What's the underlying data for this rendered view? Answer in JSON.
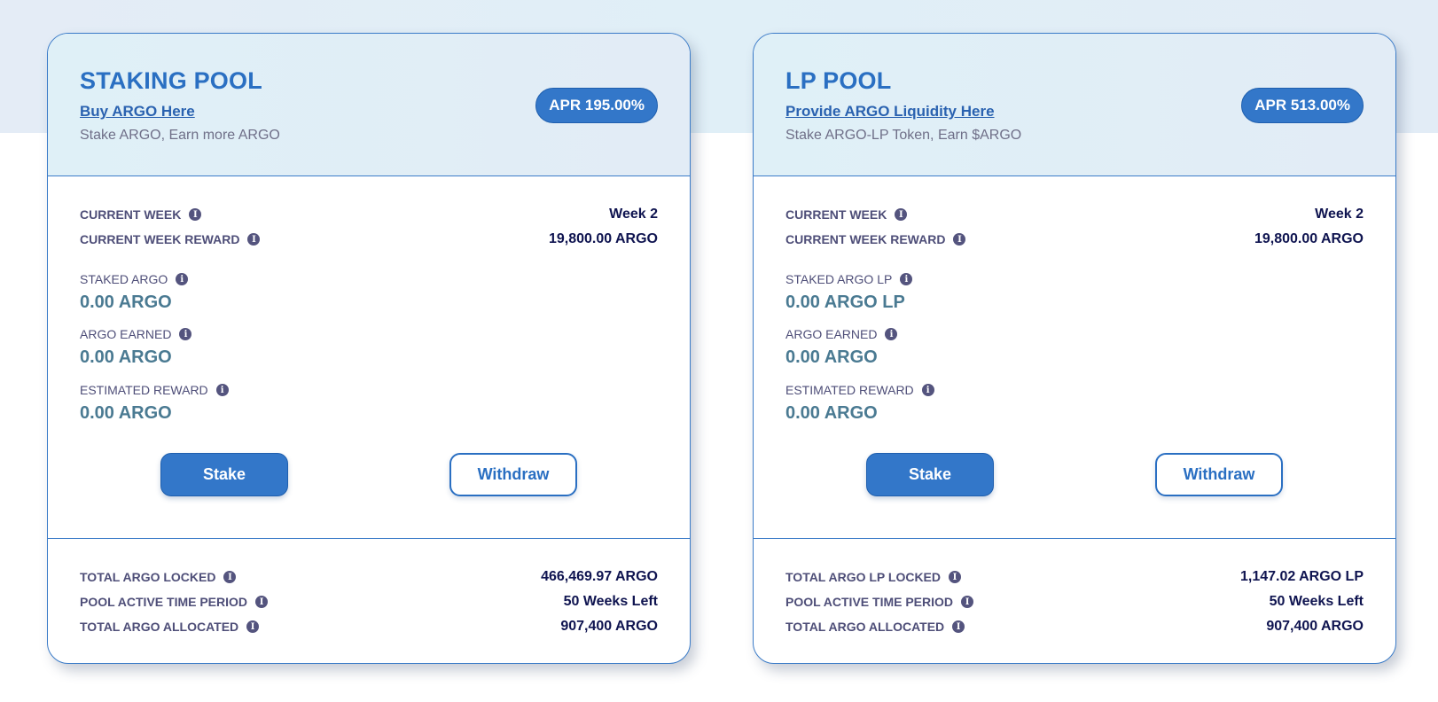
{
  "pools": [
    {
      "title": "STAKING POOL",
      "link": "Buy ARGO Here",
      "subtitle": "Stake ARGO, Earn more ARGO",
      "apr": "APR 195.00%",
      "current_week_label": "CURRENT WEEK",
      "current_week_value": "Week 2",
      "current_week_reward_label": "CURRENT WEEK REWARD",
      "current_week_reward_value": "19,800.00 ARGO",
      "staked_label": "STAKED ARGO",
      "staked_value": "0.00 ARGO",
      "earned_label": "ARGO EARNED",
      "earned_value": "0.00 ARGO",
      "estimated_label": "ESTIMATED REWARD",
      "estimated_value": "0.00 ARGO",
      "stake_button": "Stake",
      "withdraw_button": "Withdraw",
      "total_locked_label": "TOTAL ARGO LOCKED",
      "total_locked_value": "466,469.97 ARGO",
      "active_period_label": "POOL ACTIVE TIME PERIOD",
      "active_period_value": "50 Weeks Left",
      "total_allocated_label": "TOTAL ARGO ALLOCATED",
      "total_allocated_value": "907,400 ARGO"
    },
    {
      "title": "LP POOL",
      "link": "Provide ARGO Liquidity Here",
      "subtitle": "Stake ARGO-LP Token, Earn $ARGO",
      "apr": "APR 513.00%",
      "current_week_label": "CURRENT WEEK",
      "current_week_value": "Week 2",
      "current_week_reward_label": "CURRENT WEEK REWARD",
      "current_week_reward_value": "19,800.00 ARGO",
      "staked_label": "STAKED ARGO LP",
      "staked_value": "0.00 ARGO LP",
      "earned_label": "ARGO EARNED",
      "earned_value": "0.00 ARGO",
      "estimated_label": "ESTIMATED REWARD",
      "estimated_value": "0.00 ARGO",
      "stake_button": "Stake",
      "withdraw_button": "Withdraw",
      "total_locked_label": "TOTAL ARGO LP LOCKED",
      "total_locked_value": "1,147.02 ARGO LP",
      "active_period_label": "POOL ACTIVE TIME PERIOD",
      "active_period_value": "50 Weeks Left",
      "total_allocated_label": "TOTAL ARGO ALLOCATED",
      "total_allocated_value": "907,400 ARGO"
    }
  ],
  "info_icon_glyph": "i",
  "colors": {
    "accent": "#3377c9",
    "title": "#2a6fc2",
    "label": "#4e4e78",
    "value_dark": "#0f1450",
    "value_muted": "#4a7a92",
    "border": "#3a7bc8"
  }
}
